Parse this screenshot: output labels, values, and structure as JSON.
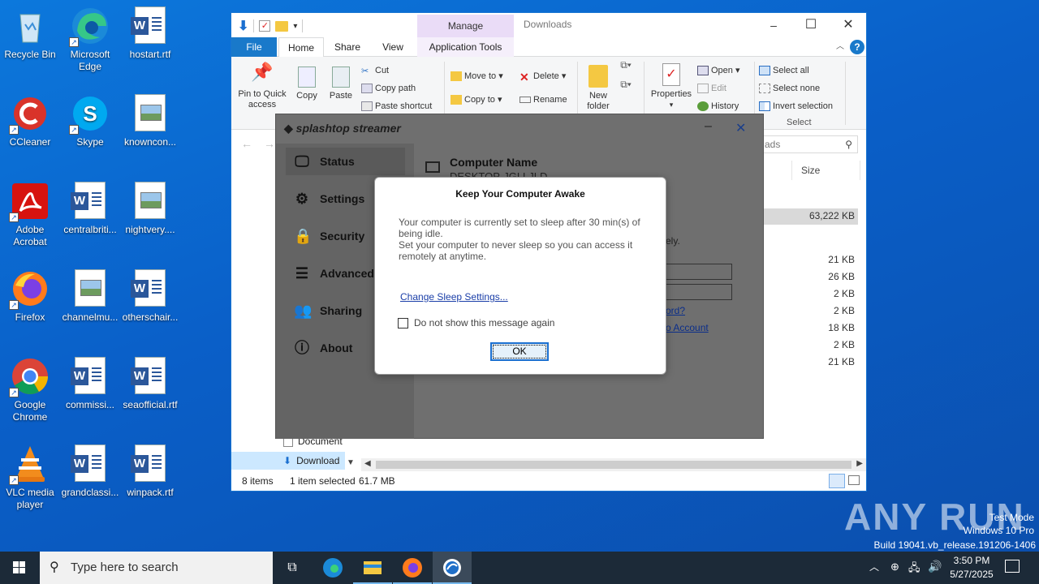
{
  "desktop": {
    "icons": [
      {
        "label": "Recycle Bin"
      },
      {
        "label": "Microsoft Edge"
      },
      {
        "label": "hostart.rtf"
      },
      {
        "label": "CCleaner"
      },
      {
        "label": "Skype"
      },
      {
        "label": "knowncon..."
      },
      {
        "label": "Adobe Acrobat"
      },
      {
        "label": "centralbriti..."
      },
      {
        "label": "nightvery...."
      },
      {
        "label": "Firefox"
      },
      {
        "label": "channelmu..."
      },
      {
        "label": "otherschair..."
      },
      {
        "label": "Google Chrome"
      },
      {
        "label": "commissi..."
      },
      {
        "label": "seaofficial.rtf"
      },
      {
        "label": "VLC media player"
      },
      {
        "label": "grandclassi..."
      },
      {
        "label": "winpack.rtf"
      }
    ]
  },
  "explorer": {
    "title": "Downloads",
    "manage_label": "Manage",
    "tabs": {
      "file": "File",
      "home": "Home",
      "share": "Share",
      "view": "View",
      "app_tools": "Application Tools"
    },
    "ribbon": {
      "pin": "Pin to Quick access",
      "copy": "Copy",
      "paste": "Paste",
      "cut": "Cut",
      "copy_path": "Copy path",
      "paste_shortcut": "Paste shortcut",
      "move_to": "Move to",
      "copy_to": "Copy to",
      "delete": "Delete",
      "rename": "Rename",
      "new_folder": "New folder",
      "properties": "Properties",
      "open": "Open",
      "edit": "Edit",
      "history": "History",
      "select_all": "Select all",
      "select_none": "Select none",
      "invert_selection": "Invert selection",
      "select_group": "Select"
    },
    "search_placeholder": "ads",
    "size_header": "Size",
    "sizes": [
      "63,222 KB",
      "21 KB",
      "26 KB",
      "2 KB",
      "2 KB",
      "18 KB",
      "2 KB",
      "21 KB"
    ],
    "nav": {
      "documents": "Document",
      "downloads": "Download"
    },
    "status": {
      "items": "8 items",
      "selected": "1 item selected",
      "size": "61.7 MB"
    }
  },
  "splashtop": {
    "brand": "splashtop streamer",
    "nav": [
      {
        "label": "Status"
      },
      {
        "label": "Settings"
      },
      {
        "label": "Security"
      },
      {
        "label": "Advanced"
      },
      {
        "label": "Sharing"
      },
      {
        "label": "About"
      }
    ],
    "computer_name_label": "Computer Name",
    "computer_name_value": "DESKTOP-JGLLJLD",
    "partial_text": "ely.",
    "link_password": "ord?",
    "link_account": "o Account"
  },
  "dialog": {
    "title": "Keep Your Computer Awake",
    "message1": "Your computer is currently set to sleep after 30 min(s) of being idle.",
    "message2": "Set your computer to never sleep so you can access it remotely at anytime.",
    "link": "Change Sleep Settings...",
    "checkbox_label": "Do not show this message again",
    "ok": "OK"
  },
  "taskbar": {
    "search_placeholder": "Type here to search",
    "time": "3:50 PM",
    "date": "5/27/2025"
  },
  "watermark": {
    "brand": "ANY RUN",
    "line1": "Test Mode",
    "line2": "Windows 10 Pro",
    "line3": "Build 19041.vb_release.191206-1406"
  }
}
